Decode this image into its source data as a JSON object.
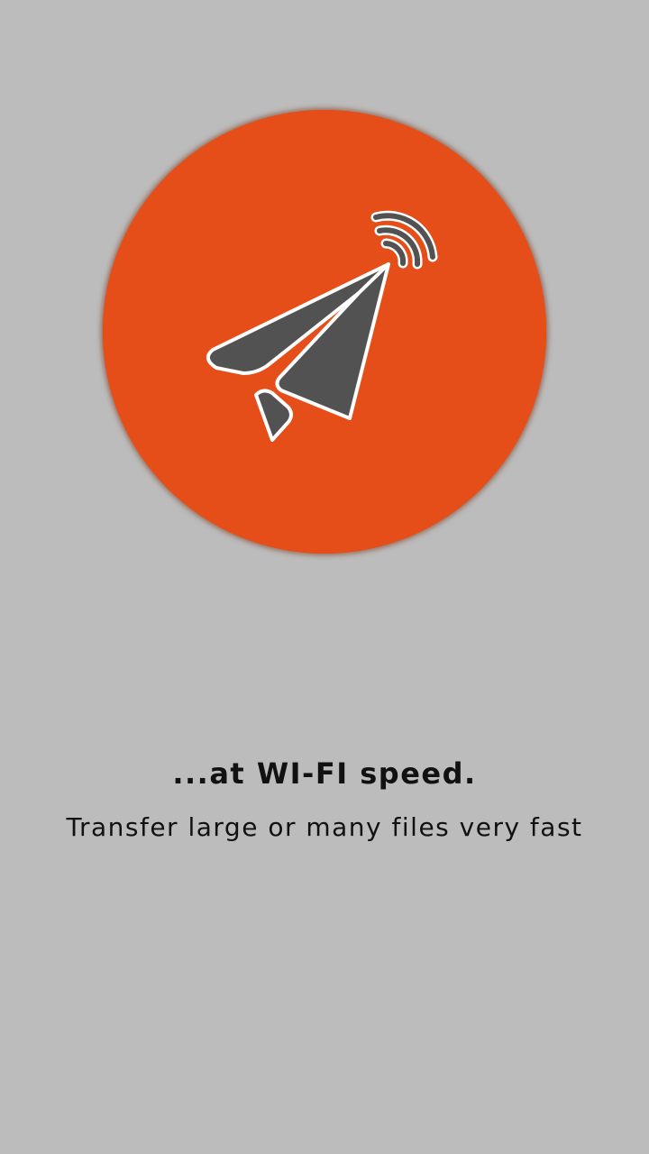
{
  "onboarding": {
    "headline": "...at WI-FI speed.",
    "subline": "Transfer large or many files very fast"
  },
  "logo": {
    "icon": "paper-plane-wifi-icon"
  },
  "colors": {
    "background": "#bcbcbc",
    "circle": "#e54d19",
    "icon_fill": "#525252",
    "icon_outline": "#ffffff",
    "text": "#111111"
  }
}
